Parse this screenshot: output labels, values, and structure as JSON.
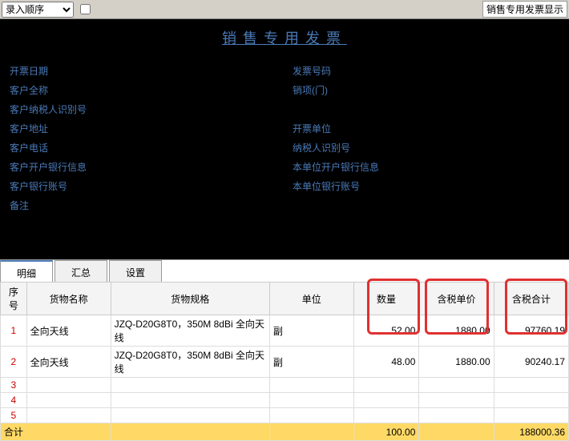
{
  "topbar": {
    "dropdown_selected": "录入顺序",
    "checkbox_label": "",
    "right_badge": "销售专用发票显示"
  },
  "header": {
    "title": "销售专用发票",
    "left_fields": {
      "f1_label": "开票日期",
      "f2_label": "客户全称",
      "f3_label": "客户纳税人识别号",
      "f4_label": "客户地址",
      "f5_label": "客户电话",
      "f6_label": "客户开户银行信息",
      "f7_label": "客户银行账号",
      "f8_label": "备注"
    },
    "right_fields": {
      "r1_label": "发票号码",
      "r2_label": "销项(门)",
      "r3_label": "",
      "r4_label": "开票单位",
      "r5_label": "纳税人识别号",
      "r6_label": "本单位开户银行信息",
      "r7_label": "本单位银行账号"
    }
  },
  "tabs": {
    "t1": "明细",
    "t2": "汇总",
    "t3": "设置"
  },
  "table": {
    "headers": {
      "seq": "序号",
      "name": "货物名称",
      "spec": "货物规格",
      "unit": "单位",
      "qty": "数量",
      "price": "含税单价",
      "total": "含税合计"
    },
    "rows": [
      {
        "seq": "1",
        "name": "全向天线",
        "spec": "JZQ-D20G8T0，350M 8dBi 全向天线",
        "unit": "副",
        "qty": "52.00",
        "price": "1880.00",
        "total": "97760.19"
      },
      {
        "seq": "2",
        "name": "全向天线",
        "spec": "JZQ-D20G8T0，350M 8dBi 全向天线",
        "unit": "副",
        "qty": "48.00",
        "price": "1880.00",
        "total": "90240.17"
      },
      {
        "seq": "3",
        "name": "",
        "spec": "",
        "unit": "",
        "qty": "",
        "price": "",
        "total": ""
      },
      {
        "seq": "4",
        "name": "",
        "spec": "",
        "unit": "",
        "qty": "",
        "price": "",
        "total": ""
      },
      {
        "seq": "5",
        "name": "",
        "spec": "",
        "unit": "",
        "qty": "",
        "price": "",
        "total": ""
      }
    ],
    "footer": {
      "label": "合计",
      "qty": "100.00",
      "total": "188000.36"
    }
  }
}
